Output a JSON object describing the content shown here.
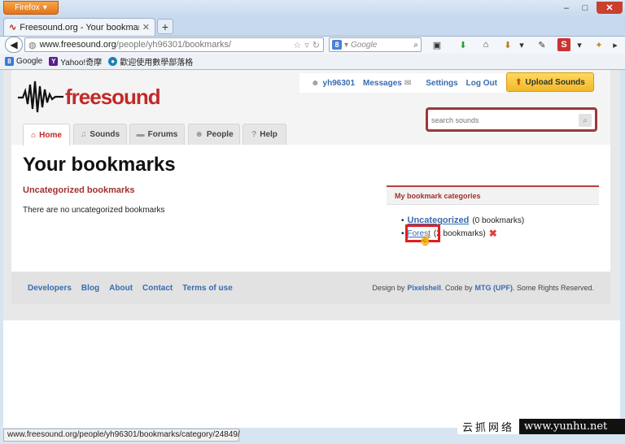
{
  "browser": {
    "app_button": "Firefox",
    "tab_title": "Freesound.org - Your bookmarks",
    "url_domain": "www.freesound.org",
    "url_path": "/people/yh96301/bookmarks/",
    "search_placeholder": "Google",
    "bookmarks": [
      {
        "label": "Google",
        "icon": "google-icon",
        "color": "#3b78d8",
        "glyph": "8"
      },
      {
        "label": "Yahoo!奇摩",
        "icon": "yahoo-icon",
        "color": "#5f1b8f",
        "glyph": "Y"
      },
      {
        "label": "歡迎使用數學部落格",
        "icon": "blog-icon",
        "color": "#1f7fb8",
        "glyph": "●"
      }
    ],
    "status_url": "www.freesound.org/people/yh96301/bookmarks/category/24849/"
  },
  "site": {
    "logo_text": "freesound",
    "user": "yh96301",
    "messages": "Messages",
    "settings": "Settings",
    "logout": "Log Out",
    "upload": "Upload Sounds",
    "search_placeholder": "search sounds",
    "tabs": [
      {
        "label": "Home",
        "icon": "home-icon",
        "glyph": "⌂"
      },
      {
        "label": "Sounds",
        "icon": "headphones-icon",
        "glyph": "♫"
      },
      {
        "label": "Forums",
        "icon": "speech-bubble-icon",
        "glyph": "▬"
      },
      {
        "label": "People",
        "icon": "people-icon",
        "glyph": "☻"
      },
      {
        "label": "Help",
        "icon": "help-icon",
        "glyph": "?"
      }
    ],
    "accent": "#c12a2a",
    "link_color": "#3a6bb0"
  },
  "main": {
    "title": "Your bookmarks",
    "subheading": "Uncategorized bookmarks",
    "message": "There are no uncategorized bookmarks"
  },
  "categories": {
    "heading": "My bookmark categories",
    "items": [
      {
        "name": "Uncategorized",
        "count": "(0 bookmarks)"
      },
      {
        "name": "Forest",
        "count": "(2 bookmarks)"
      }
    ]
  },
  "footer": {
    "links": [
      "Developers",
      "Blog",
      "About",
      "Contact",
      "Terms of use"
    ],
    "credit_prefix": "Design by",
    "designer": "Pixelshell",
    "code_by": ". Code by",
    "code_org": "MTG (UPF)",
    "rights": ". Some Rights Reserved."
  },
  "watermark": {
    "cn": "云抓网络",
    "url": "www.yunhu.net"
  }
}
